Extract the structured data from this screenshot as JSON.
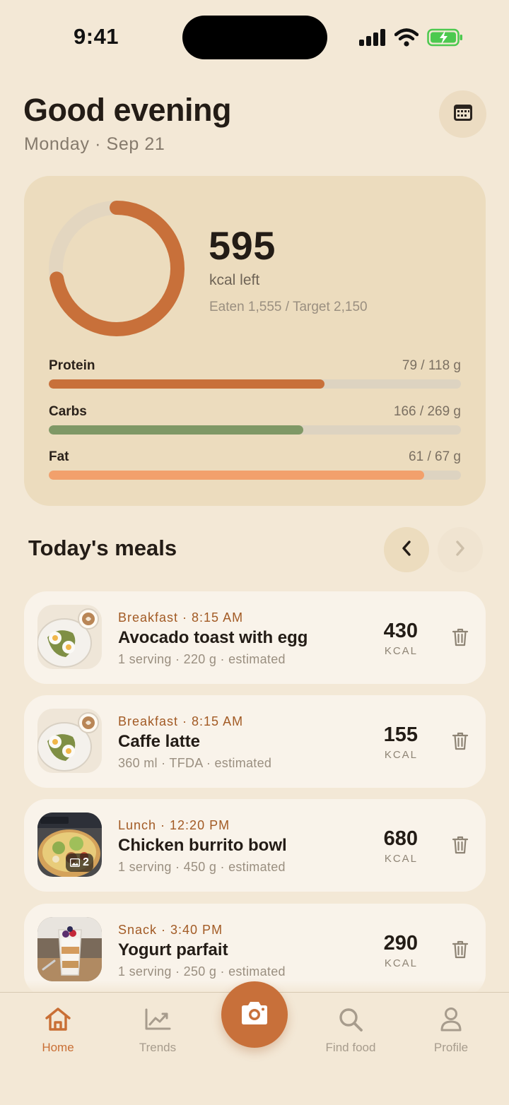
{
  "status_bar": {
    "time": "9:41"
  },
  "header": {
    "greeting": "Good evening",
    "date": "Monday · Sep 21"
  },
  "summary": {
    "kcal_left": "595",
    "kcal_label": "kcal left",
    "eaten_line": "Eaten 1,555 / Target 2,150",
    "ring_progress": 0.723,
    "macros": [
      {
        "name": "Protein",
        "amount": "79 / 118 g",
        "progress": 0.669,
        "color": "#c8703a"
      },
      {
        "name": "Carbs",
        "amount": "166 / 269 g",
        "progress": 0.617,
        "color": "#7f9866"
      },
      {
        "name": "Fat",
        "amount": "61 / 67 g",
        "progress": 0.91,
        "color": "#f2a06c"
      }
    ]
  },
  "meals_section": {
    "title": "Today's meals"
  },
  "meals": [
    {
      "meta": "Breakfast · 8:15 AM",
      "name": "Avocado toast with egg",
      "detail": "1 serving · 220 g · estimated",
      "kcal": "430",
      "unit": "KCAL",
      "photo": "avocado-toast"
    },
    {
      "meta": "Breakfast · 8:15 AM",
      "name": "Caffe latte",
      "detail": "360 ml · TFDA · estimated",
      "kcal": "155",
      "unit": "KCAL",
      "photo": "avocado-toast"
    },
    {
      "meta": "Lunch · 12:20 PM",
      "name": "Chicken burrito bowl",
      "detail": "1 serving · 450 g · estimated",
      "kcal": "680",
      "unit": "KCAL",
      "photo": "burrito-bowl",
      "photo_count": "2"
    },
    {
      "meta": "Snack · 3:40 PM",
      "name": "Yogurt parfait",
      "detail": "1 serving · 250 g · estimated",
      "kcal": "290",
      "unit": "KCAL",
      "photo": "yogurt-parfait"
    }
  ],
  "tab_bar": {
    "home": "Home",
    "trends": "Trends",
    "find_food": "Find food",
    "profile": "Profile"
  },
  "colors": {
    "accent": "#c8703a",
    "background": "#f3e8d6",
    "card": "#ecdcbe"
  }
}
